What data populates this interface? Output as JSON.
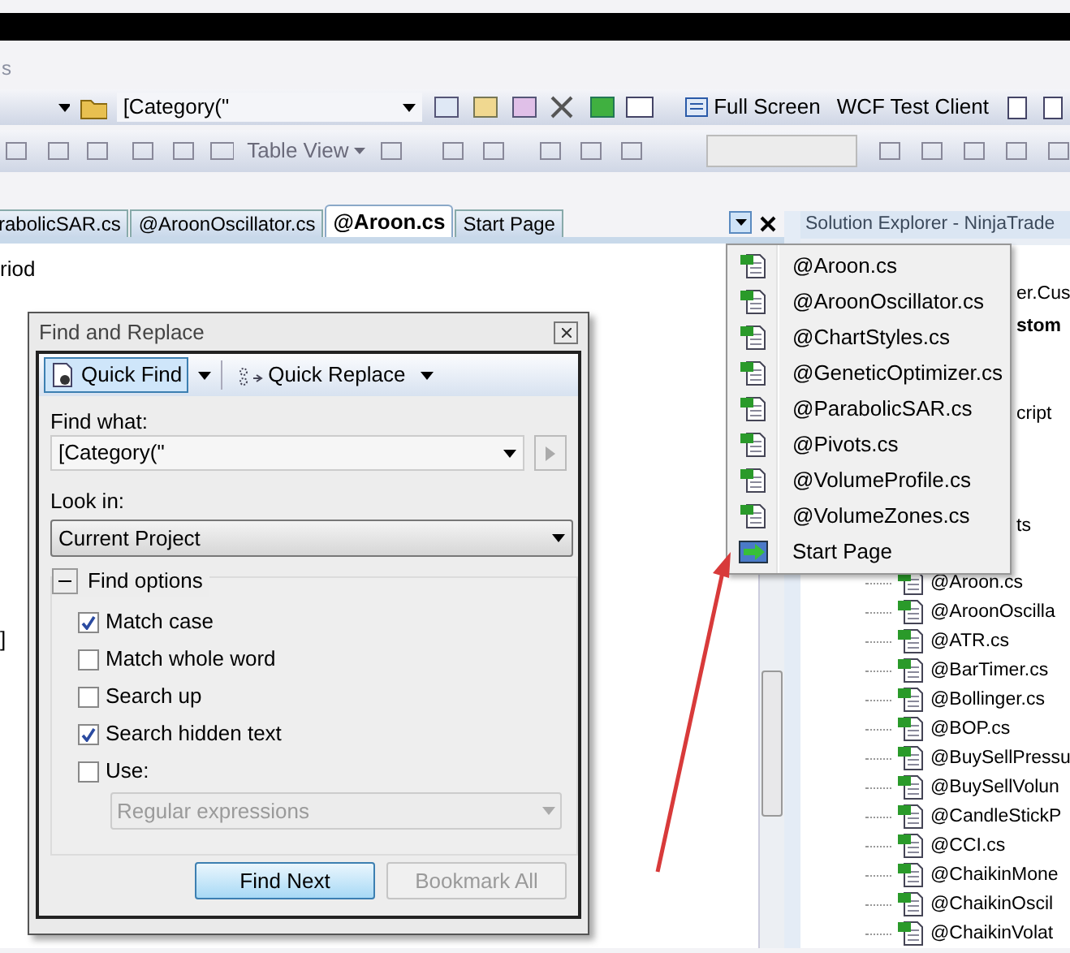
{
  "menu_bar": {
    "items": [
      "s"
    ]
  },
  "toolbar_1": {
    "find_combo": "[Category(\"",
    "buttons": [
      "Full Screen",
      "WCF Test Client"
    ]
  },
  "toolbar_2": {
    "table_view": "Table View"
  },
  "tabs": [
    {
      "label": "rabolicSAR.cs",
      "selected": false
    },
    {
      "label": "@AroonOscillator.cs",
      "selected": false
    },
    {
      "label": "@Aroon.cs",
      "selected": true
    },
    {
      "label": "Start Page",
      "selected": false
    }
  ],
  "editor": {
    "lines": [
      {
        "text": "riod"
      },
      {
        "text": "]"
      }
    ]
  },
  "solution_explorer": {
    "title": "Solution Explorer - NinjaTrade",
    "items": [
      {
        "label": "er.Cus",
        "kind": "text",
        "bold": false
      },
      {
        "label": "stom",
        "kind": "text",
        "bold": true
      },
      {
        "label": "cript",
        "kind": "text",
        "bold": false
      },
      {
        "label": "ts",
        "kind": "text",
        "bold": false
      },
      {
        "label": "@Aroon.cs",
        "kind": "file",
        "bold": false
      },
      {
        "label": "@AroonOscilla",
        "kind": "file",
        "bold": false
      },
      {
        "label": "@ATR.cs",
        "kind": "file",
        "bold": false
      },
      {
        "label": "@BarTimer.cs",
        "kind": "file",
        "bold": false
      },
      {
        "label": "@Bollinger.cs",
        "kind": "file",
        "bold": false
      },
      {
        "label": "@BOP.cs",
        "kind": "file",
        "bold": false
      },
      {
        "label": "@BuySellPressu",
        "kind": "file",
        "bold": false
      },
      {
        "label": "@BuySellVolun",
        "kind": "file",
        "bold": false
      },
      {
        "label": "@CandleStickP",
        "kind": "file",
        "bold": false
      },
      {
        "label": "@CCI.cs",
        "kind": "file",
        "bold": false
      },
      {
        "label": "@ChaikinMone",
        "kind": "file",
        "bold": false
      },
      {
        "label": "@ChaikinOscil",
        "kind": "file",
        "bold": false
      },
      {
        "label": "@ChaikinVolat",
        "kind": "file",
        "bold": false
      }
    ]
  },
  "window_menu": {
    "items": [
      {
        "label": "@Aroon.cs",
        "kind": "file"
      },
      {
        "label": "@AroonOscillator.cs",
        "kind": "file"
      },
      {
        "label": "@ChartStyles.cs",
        "kind": "file"
      },
      {
        "label": "@GeneticOptimizer.cs",
        "kind": "file"
      },
      {
        "label": "@ParabolicSAR.cs",
        "kind": "file"
      },
      {
        "label": "@Pivots.cs",
        "kind": "file"
      },
      {
        "label": "@VolumeProfile.cs",
        "kind": "file"
      },
      {
        "label": "@VolumeZones.cs",
        "kind": "file"
      },
      {
        "label": "Start Page",
        "kind": "page"
      }
    ]
  },
  "find_dialog": {
    "title": "Find and Replace",
    "modes": [
      {
        "label": "Quick Find",
        "selected": true
      },
      {
        "label": "Quick Replace",
        "selected": false
      }
    ],
    "find_what": {
      "label": "Find what:",
      "value": "[Category(\""
    },
    "look_in": {
      "label": "Look in:",
      "value": "Current Project"
    },
    "find_options": {
      "label": "Find options",
      "expanded": true,
      "options": [
        {
          "label": "Match case",
          "checked": true
        },
        {
          "label": "Match whole word",
          "checked": false
        },
        {
          "label": "Search up",
          "checked": false
        },
        {
          "label": "Search hidden text",
          "checked": true
        },
        {
          "label": "Use:",
          "checked": false
        }
      ],
      "use_combo": {
        "value": "Regular expressions",
        "disabled": true
      }
    },
    "buttons": [
      {
        "label": "Find Next",
        "disabled": false
      },
      {
        "label": "Bookmark All",
        "disabled": true
      }
    ]
  }
}
